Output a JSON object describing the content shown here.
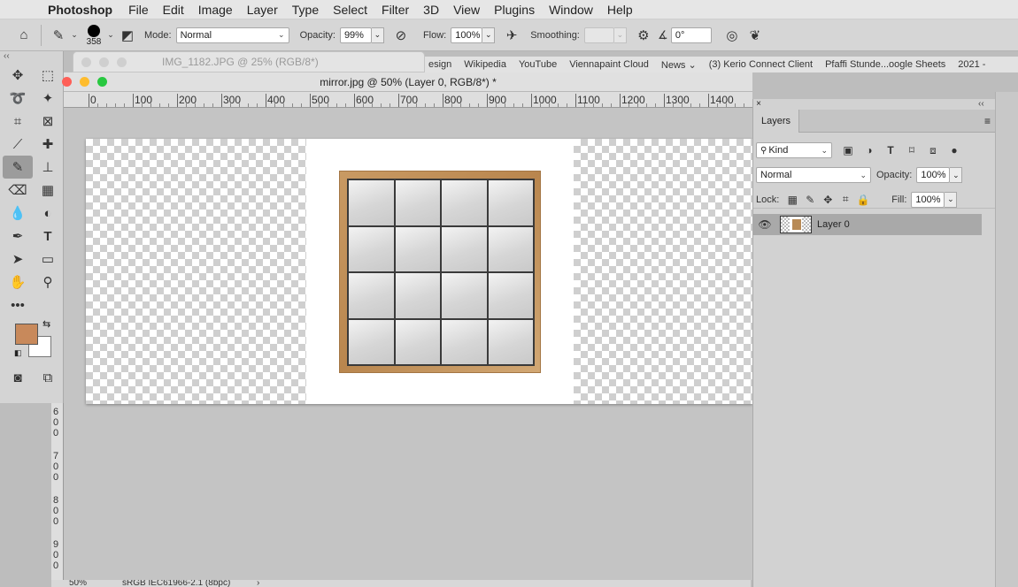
{
  "menubar": {
    "apple_glyph": "",
    "app_name": "Photoshop",
    "items": [
      "File",
      "Edit",
      "Image",
      "Layer",
      "Type",
      "Select",
      "Filter",
      "3D",
      "View",
      "Plugins",
      "Window",
      "Help"
    ]
  },
  "options_bar": {
    "brush_size": "358",
    "mode_label": "Mode:",
    "mode_value": "Normal",
    "opacity_label": "Opacity:",
    "opacity_value": "99%",
    "flow_label": "Flow:",
    "flow_value": "100%",
    "smoothing_label": "Smoothing:",
    "smoothing_value": "",
    "angle_value": "0°"
  },
  "background_document": {
    "title": "IMG_1182.JPG @ 25% (RGB/8*)"
  },
  "bookmarks": [
    "esign",
    "Wikipedia",
    "YouTube",
    "Viennapaint Cloud",
    "News ⌄",
    "(3) Kerio Connect Client",
    "Pfaffi Stunde...oogle Sheets",
    "2021 -"
  ],
  "document": {
    "title": "mirror.jpg @ 50% (Layer 0, RGB/8*) *"
  },
  "ruler": {
    "h_labels": [
      "0",
      "100",
      "200",
      "300",
      "400",
      "500",
      "600",
      "700",
      "800",
      "900",
      "1000",
      "1100",
      "1200",
      "1300",
      "1400"
    ],
    "v_labels": [
      "6\n0\n0",
      "7\n0\n0",
      "8\n0\n0",
      "9\n0\n0"
    ]
  },
  "status": {
    "zoom": "50%",
    "profile": "sRGB IEC61966-2.1 (8bpc)"
  },
  "colors": {
    "foreground": "#c8895b",
    "background": "#ffffff"
  },
  "layers_panel": {
    "tab_label": "Layers",
    "filter_kind": "Kind",
    "blend_mode": "Normal",
    "opacity_label": "Opacity:",
    "opacity_value": "100%",
    "lock_label": "Lock:",
    "fill_label": "Fill:",
    "fill_value": "100%",
    "layers": [
      {
        "name": "Layer 0",
        "visible": true
      }
    ]
  }
}
